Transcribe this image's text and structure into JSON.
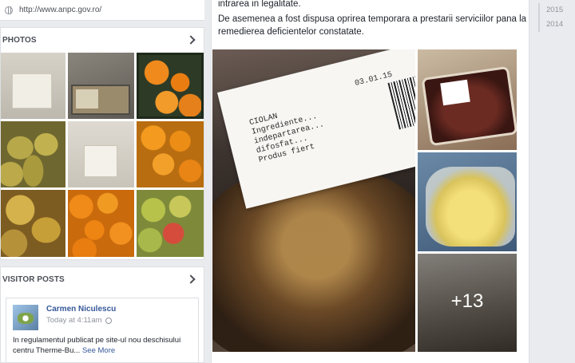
{
  "sidebar": {
    "url": "http://www.anpc.gov.ro/",
    "photos_title": "PHOTOS",
    "visitor_posts_title": "VISITOR POSTS",
    "visitor_post": {
      "author": "Carmen Niculescu",
      "time": "Today at 4:11am",
      "text": "In regulamentul publicat pe site-ul nou deschisului centru Therme-Bu...",
      "see_more": "See More"
    }
  },
  "post": {
    "line1": "intrarea in legalitate.",
    "line2": "De asemenea a fost dispusa oprirea temporara a prestarii serviciilor pana la",
    "line3": "remedierea deficientelor constatate.",
    "more_photos": "+13",
    "photo_label_text": "CIOLAN\nIngrediente...\nindepartarea...\ndifosfat...\nProdus fiert",
    "photo_label_date": "03.01.15"
  },
  "timeline": {
    "years": [
      "2015",
      "2014"
    ]
  }
}
